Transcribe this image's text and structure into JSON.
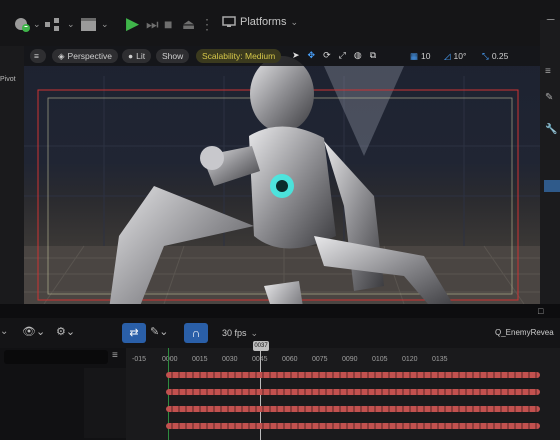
{
  "toolbar": {
    "platforms_label": "Platforms",
    "accent_green": "#3fb54a"
  },
  "left_panel": {
    "fragment": "Pivot"
  },
  "viewport": {
    "perspective_label": "Perspective",
    "lit_label": "Lit",
    "show_label": "Show",
    "scalability_label": "Scalability: Medium",
    "grid_snap_value": "10",
    "rotation_snap_value": "10°",
    "scale_snap_value": "0.25"
  },
  "sequencer": {
    "fps_label": "30 fps",
    "current_frame": "0037",
    "sequence_name_fragment": "Q_EnemyRevea",
    "ticks": [
      "-015",
      "0000",
      "0015",
      "0030",
      "0045",
      "0060",
      "0075",
      "0090",
      "0105",
      "0120",
      "0135"
    ],
    "track_color": "#c2514f"
  }
}
